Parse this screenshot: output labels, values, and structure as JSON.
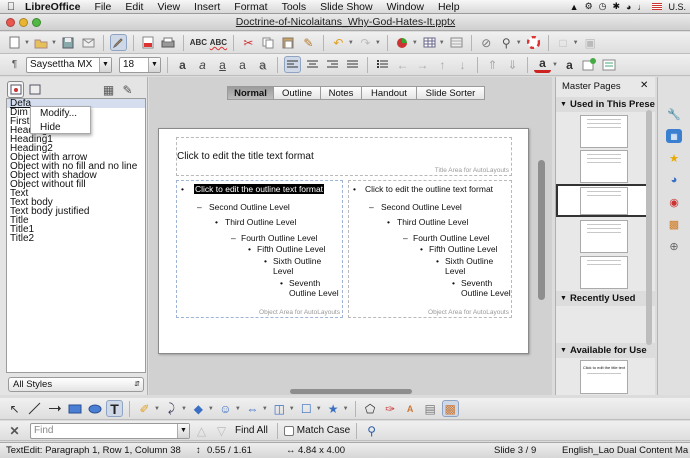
{
  "menubar": {
    "app": "LibreOffice",
    "items": [
      "File",
      "Edit",
      "View",
      "Insert",
      "Format",
      "Tools",
      "Slide Show",
      "Window",
      "Help"
    ],
    "locale": "U.S."
  },
  "window": {
    "title": "Doctrine-of-Nicolaitans_Why-God-Hates-It.pptx"
  },
  "format_toolbar": {
    "font_name": "Saysettha MX",
    "font_size": "18"
  },
  "styles_pane": {
    "items": [
      "Defa",
      "Dim",
      "First",
      "Heading",
      "Heading1",
      "Heading2",
      "Object with arrow",
      "Object with no fill and no line",
      "Object with shadow",
      "Object without fill",
      "Text",
      "Text body",
      "Text body justified",
      "Title",
      "Title1",
      "Title2"
    ],
    "filter": "All Styles",
    "context_menu": [
      "Modify...",
      "Hide"
    ]
  },
  "view_tabs": [
    "Normal",
    "Outline",
    "Notes",
    "Handout",
    "Slide Sorter"
  ],
  "active_tab": "Normal",
  "slide": {
    "title": "Click to edit the title text format",
    "title_hint": "Title Area for AutoLayouts",
    "object_hint": "Object Area for AutoLayouts",
    "left": {
      "lines": [
        "Click to edit the outline text format",
        "Second Outline Level",
        "Third Outline Level",
        "Fourth Outline Level",
        "Fifth Outline Level",
        "Sixth Outline",
        "Level",
        "Seventh",
        "Outline Level"
      ]
    },
    "right": {
      "lines": [
        "Click to edit the outline text format",
        "Second Outline Level",
        "Third Outline Level",
        "Fourth Outline Level",
        "Fifth Outline Level",
        "Sixth Outline",
        "Level",
        "Seventh",
        "Outline Level"
      ]
    }
  },
  "master_pages": {
    "title": "Master Pages",
    "sections": [
      "Used in This Prese",
      "Recently Used",
      "Available for Use"
    ],
    "thumb_title": "Click to edit the title text"
  },
  "find": {
    "placeholder": "Find",
    "find_all": "Find All",
    "match_case": "Match Case"
  },
  "status": {
    "text_edit": "TextEdit: Paragraph 1, Row 1, Column 38",
    "position": "0.55 / 1.61",
    "size": "4.84 x 4.00",
    "slide": "Slide 3 / 9",
    "master": "English_Lao Dual Content Ma"
  },
  "colors": {
    "selection": "#000000",
    "accent": "#3a6fc4"
  }
}
